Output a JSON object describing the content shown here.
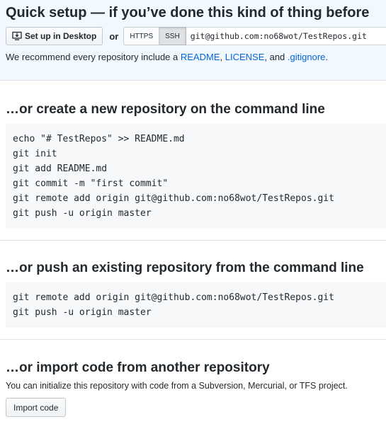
{
  "quick_setup": {
    "title": "Quick setup — if you’ve done this kind of thing before",
    "desktop_button_label": "Set up in Desktop",
    "or_label": "or",
    "protocol_options": [
      "HTTPS",
      "SSH"
    ],
    "selected_protocol": "SSH",
    "clone_url": "git@github.com:no68wot/TestRepos.git",
    "recommend": {
      "prefix": "We recommend every repository include a ",
      "readme": "README",
      "sep1": ", ",
      "license": "LICENSE",
      "sep2": ", and ",
      "gitignore": ".gitignore",
      "suffix": "."
    }
  },
  "new_repo": {
    "heading": "…or create a new repository on the command line",
    "lines": [
      "echo \"# TestRepos\" >> README.md",
      "git init",
      "git add README.md",
      "git commit -m \"first commit\"",
      "git remote add origin git@github.com:no68wot/TestRepos.git",
      "git push -u origin master"
    ]
  },
  "push_existing": {
    "heading": "…or push an existing repository from the command line",
    "lines": [
      "git remote add origin git@github.com:no68wot/TestRepos.git",
      "git push -u origin master"
    ]
  },
  "import_code": {
    "heading": "…or import code from another repository",
    "description": "You can initialize this repository with code from a Subversion, Mercurial, or TFS project.",
    "button_label": "Import code"
  },
  "colors": {
    "quick_setup_bg": "#f1f8ff",
    "link": "#0366d6",
    "code_bg": "#f6f8fa"
  }
}
